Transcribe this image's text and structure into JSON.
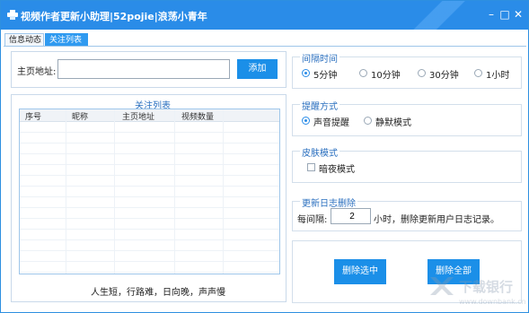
{
  "window": {
    "title": "视频作者更新小助理|52pojie|浪荡小青年"
  },
  "tabs": [
    {
      "label": "信息动态"
    },
    {
      "label": "关注列表"
    }
  ],
  "homepage": {
    "label": "主页地址:",
    "value": "",
    "add_button": "添加"
  },
  "follow_list": {
    "title": "关注列表",
    "columns": [
      "序号",
      "昵称",
      "主页地址",
      "视频数量"
    ],
    "rows": [],
    "footer_text": "人生短，行路难，日向晚，声声慢"
  },
  "interval": {
    "title": "间隔时间",
    "options": [
      {
        "label": "5分钟",
        "selected": true
      },
      {
        "label": "10分钟",
        "selected": false
      },
      {
        "label": "30分钟",
        "selected": false
      },
      {
        "label": "1小时",
        "selected": false
      }
    ]
  },
  "reminder": {
    "title": "提醒方式",
    "options": [
      {
        "label": "声音提醒",
        "selected": true
      },
      {
        "label": "静默模式",
        "selected": false
      }
    ]
  },
  "skin": {
    "title": "皮肤模式",
    "dark_label": "暗夜模式",
    "dark_checked": false
  },
  "log_cleanup": {
    "title": "更新日志删除",
    "prefix": "每间隔:",
    "value": "2",
    "suffix": "小时，删除更新用户日志记录。"
  },
  "actions": {
    "delete_selected": "删除选中",
    "delete_all": "删除全部"
  },
  "watermark": {
    "text": "下载银行",
    "url": "www.downbank.cn"
  },
  "colors": {
    "titlebar": "#2a8ce8",
    "accent_button": "#1b8fe8",
    "group_title": "#2a6fbf"
  }
}
